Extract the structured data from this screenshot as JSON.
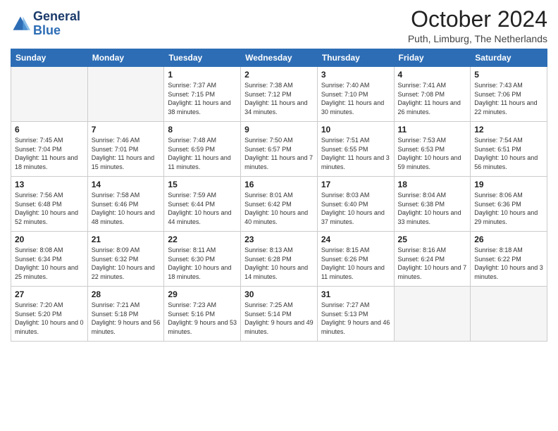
{
  "header": {
    "logo_line1": "General",
    "logo_line2": "Blue",
    "month_title": "October 2024",
    "location": "Puth, Limburg, The Netherlands"
  },
  "weekdays": [
    "Sunday",
    "Monday",
    "Tuesday",
    "Wednesday",
    "Thursday",
    "Friday",
    "Saturday"
  ],
  "weeks": [
    [
      {
        "day": "",
        "empty": true
      },
      {
        "day": "",
        "empty": true
      },
      {
        "day": "1",
        "sunrise": "Sunrise: 7:37 AM",
        "sunset": "Sunset: 7:15 PM",
        "daylight": "Daylight: 11 hours and 38 minutes."
      },
      {
        "day": "2",
        "sunrise": "Sunrise: 7:38 AM",
        "sunset": "Sunset: 7:12 PM",
        "daylight": "Daylight: 11 hours and 34 minutes."
      },
      {
        "day": "3",
        "sunrise": "Sunrise: 7:40 AM",
        "sunset": "Sunset: 7:10 PM",
        "daylight": "Daylight: 11 hours and 30 minutes."
      },
      {
        "day": "4",
        "sunrise": "Sunrise: 7:41 AM",
        "sunset": "Sunset: 7:08 PM",
        "daylight": "Daylight: 11 hours and 26 minutes."
      },
      {
        "day": "5",
        "sunrise": "Sunrise: 7:43 AM",
        "sunset": "Sunset: 7:06 PM",
        "daylight": "Daylight: 11 hours and 22 minutes."
      }
    ],
    [
      {
        "day": "6",
        "sunrise": "Sunrise: 7:45 AM",
        "sunset": "Sunset: 7:04 PM",
        "daylight": "Daylight: 11 hours and 18 minutes."
      },
      {
        "day": "7",
        "sunrise": "Sunrise: 7:46 AM",
        "sunset": "Sunset: 7:01 PM",
        "daylight": "Daylight: 11 hours and 15 minutes."
      },
      {
        "day": "8",
        "sunrise": "Sunrise: 7:48 AM",
        "sunset": "Sunset: 6:59 PM",
        "daylight": "Daylight: 11 hours and 11 minutes."
      },
      {
        "day": "9",
        "sunrise": "Sunrise: 7:50 AM",
        "sunset": "Sunset: 6:57 PM",
        "daylight": "Daylight: 11 hours and 7 minutes."
      },
      {
        "day": "10",
        "sunrise": "Sunrise: 7:51 AM",
        "sunset": "Sunset: 6:55 PM",
        "daylight": "Daylight: 11 hours and 3 minutes."
      },
      {
        "day": "11",
        "sunrise": "Sunrise: 7:53 AM",
        "sunset": "Sunset: 6:53 PM",
        "daylight": "Daylight: 10 hours and 59 minutes."
      },
      {
        "day": "12",
        "sunrise": "Sunrise: 7:54 AM",
        "sunset": "Sunset: 6:51 PM",
        "daylight": "Daylight: 10 hours and 56 minutes."
      }
    ],
    [
      {
        "day": "13",
        "sunrise": "Sunrise: 7:56 AM",
        "sunset": "Sunset: 6:48 PM",
        "daylight": "Daylight: 10 hours and 52 minutes."
      },
      {
        "day": "14",
        "sunrise": "Sunrise: 7:58 AM",
        "sunset": "Sunset: 6:46 PM",
        "daylight": "Daylight: 10 hours and 48 minutes."
      },
      {
        "day": "15",
        "sunrise": "Sunrise: 7:59 AM",
        "sunset": "Sunset: 6:44 PM",
        "daylight": "Daylight: 10 hours and 44 minutes."
      },
      {
        "day": "16",
        "sunrise": "Sunrise: 8:01 AM",
        "sunset": "Sunset: 6:42 PM",
        "daylight": "Daylight: 10 hours and 40 minutes."
      },
      {
        "day": "17",
        "sunrise": "Sunrise: 8:03 AM",
        "sunset": "Sunset: 6:40 PM",
        "daylight": "Daylight: 10 hours and 37 minutes."
      },
      {
        "day": "18",
        "sunrise": "Sunrise: 8:04 AM",
        "sunset": "Sunset: 6:38 PM",
        "daylight": "Daylight: 10 hours and 33 minutes."
      },
      {
        "day": "19",
        "sunrise": "Sunrise: 8:06 AM",
        "sunset": "Sunset: 6:36 PM",
        "daylight": "Daylight: 10 hours and 29 minutes."
      }
    ],
    [
      {
        "day": "20",
        "sunrise": "Sunrise: 8:08 AM",
        "sunset": "Sunset: 6:34 PM",
        "daylight": "Daylight: 10 hours and 25 minutes."
      },
      {
        "day": "21",
        "sunrise": "Sunrise: 8:09 AM",
        "sunset": "Sunset: 6:32 PM",
        "daylight": "Daylight: 10 hours and 22 minutes."
      },
      {
        "day": "22",
        "sunrise": "Sunrise: 8:11 AM",
        "sunset": "Sunset: 6:30 PM",
        "daylight": "Daylight: 10 hours and 18 minutes."
      },
      {
        "day": "23",
        "sunrise": "Sunrise: 8:13 AM",
        "sunset": "Sunset: 6:28 PM",
        "daylight": "Daylight: 10 hours and 14 minutes."
      },
      {
        "day": "24",
        "sunrise": "Sunrise: 8:15 AM",
        "sunset": "Sunset: 6:26 PM",
        "daylight": "Daylight: 10 hours and 11 minutes."
      },
      {
        "day": "25",
        "sunrise": "Sunrise: 8:16 AM",
        "sunset": "Sunset: 6:24 PM",
        "daylight": "Daylight: 10 hours and 7 minutes."
      },
      {
        "day": "26",
        "sunrise": "Sunrise: 8:18 AM",
        "sunset": "Sunset: 6:22 PM",
        "daylight": "Daylight: 10 hours and 3 minutes."
      }
    ],
    [
      {
        "day": "27",
        "sunrise": "Sunrise: 7:20 AM",
        "sunset": "Sunset: 5:20 PM",
        "daylight": "Daylight: 10 hours and 0 minutes."
      },
      {
        "day": "28",
        "sunrise": "Sunrise: 7:21 AM",
        "sunset": "Sunset: 5:18 PM",
        "daylight": "Daylight: 9 hours and 56 minutes."
      },
      {
        "day": "29",
        "sunrise": "Sunrise: 7:23 AM",
        "sunset": "Sunset: 5:16 PM",
        "daylight": "Daylight: 9 hours and 53 minutes."
      },
      {
        "day": "30",
        "sunrise": "Sunrise: 7:25 AM",
        "sunset": "Sunset: 5:14 PM",
        "daylight": "Daylight: 9 hours and 49 minutes."
      },
      {
        "day": "31",
        "sunrise": "Sunrise: 7:27 AM",
        "sunset": "Sunset: 5:13 PM",
        "daylight": "Daylight: 9 hours and 46 minutes."
      },
      {
        "day": "",
        "empty": true
      },
      {
        "day": "",
        "empty": true
      }
    ]
  ]
}
